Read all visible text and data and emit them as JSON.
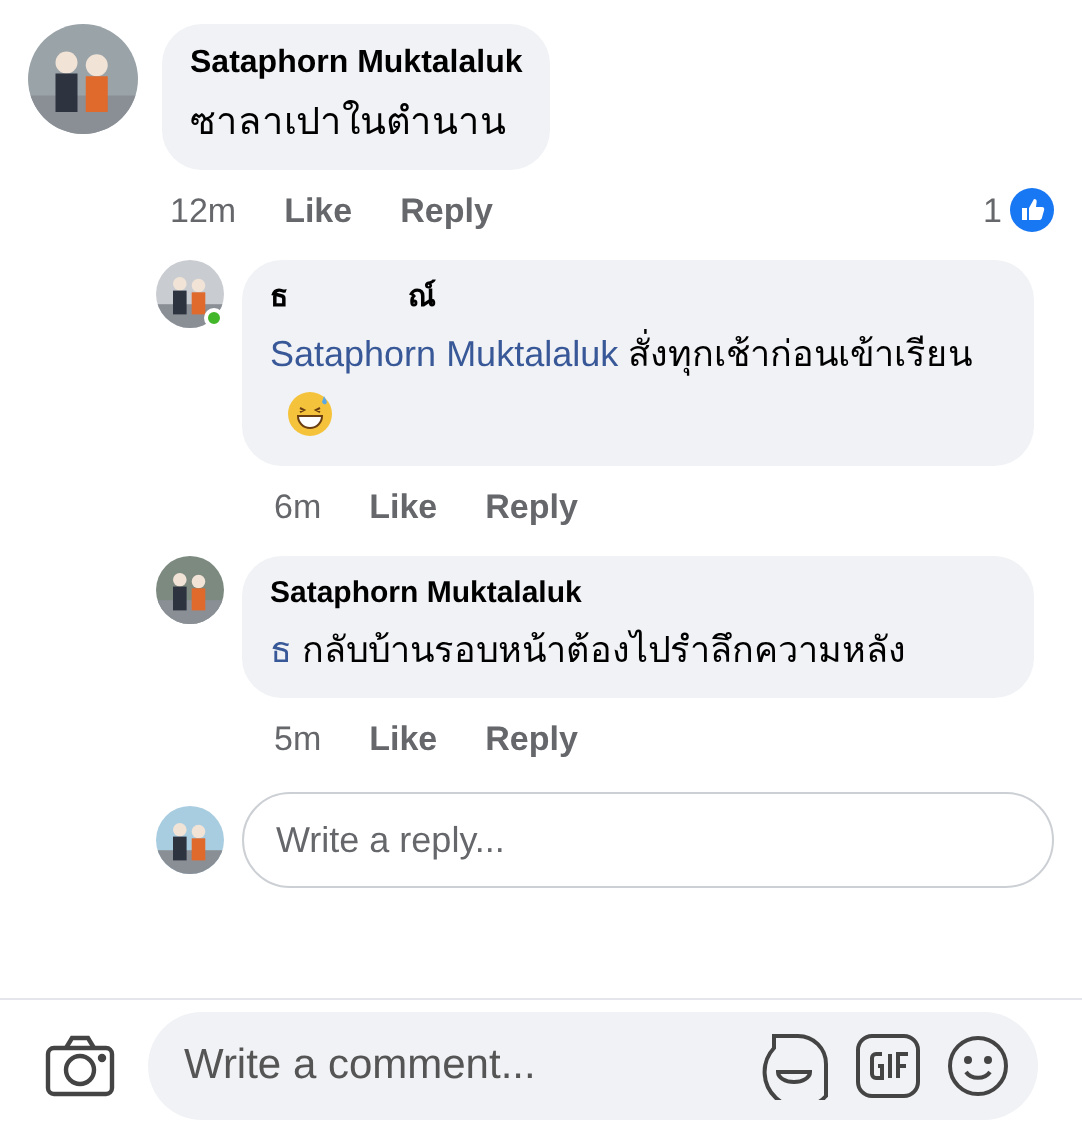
{
  "comment": {
    "author": "Sataphorn Muktalaluk",
    "text": "ซาลาเปาในตำนาน",
    "time": "12m",
    "like": "Like",
    "reply": "Reply",
    "reaction_count": "1"
  },
  "replies": [
    {
      "author_start": "ธ",
      "author_end": "ณ์",
      "online": true,
      "mention": "Sataphorn Muktalaluk",
      "text": "สั่งทุกเช้าก่อนเข้าเรียน",
      "emoji": true,
      "time": "6m",
      "like": "Like",
      "reply": "Reply"
    },
    {
      "author_start": "Sataphorn Muktalaluk",
      "online": false,
      "mention": "ธ",
      "text": "กลับบ้านรอบหน้าต้องไปรำลึกความหลัง",
      "emoji": false,
      "time": "5m",
      "like": "Like",
      "reply": "Reply"
    }
  ],
  "reply_box": {
    "placeholder": "Write a reply..."
  },
  "comment_box": {
    "placeholder": "Write a comment..."
  }
}
